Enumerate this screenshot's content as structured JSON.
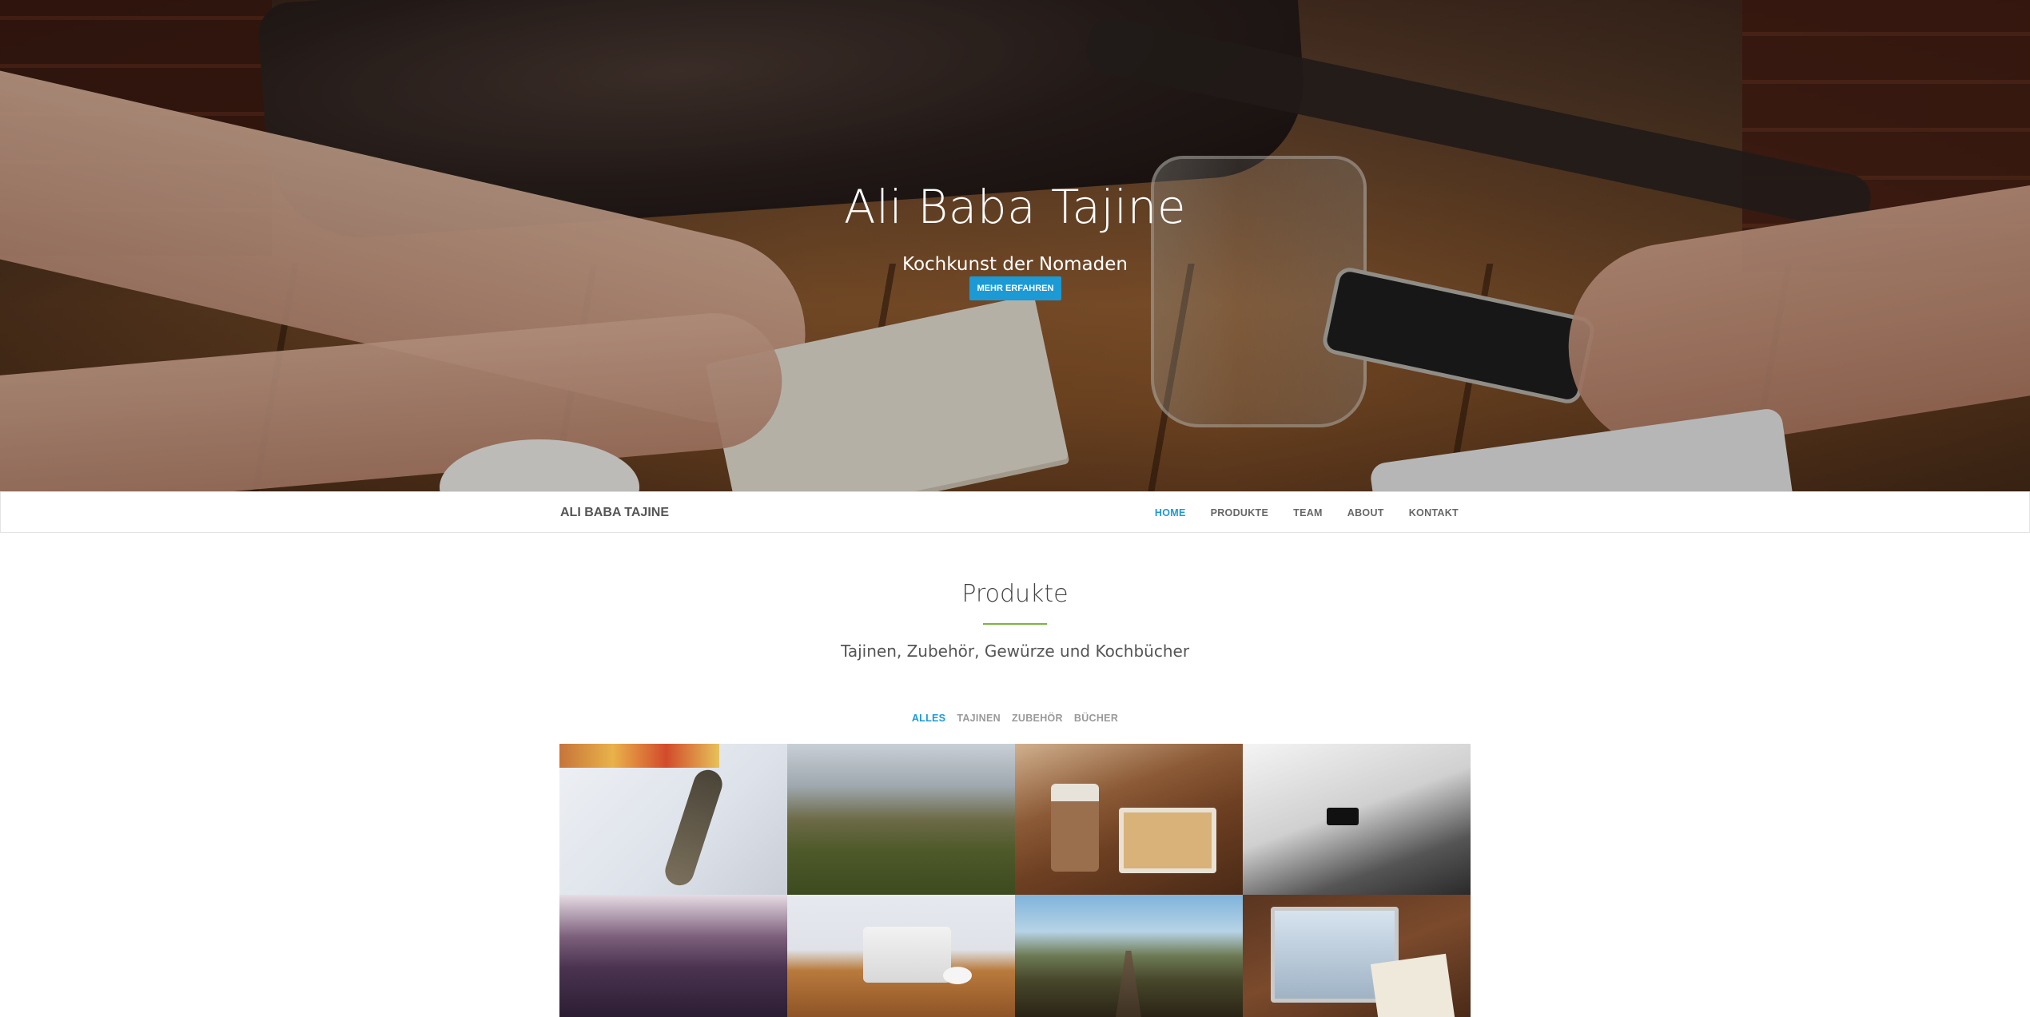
{
  "hero": {
    "title": "Ali Baba Tajine",
    "subtitle": "Kochkunst der Nomaden",
    "button_label": "MEHR ERFAHREN"
  },
  "navbar": {
    "brand": "ALI BABA TAJINE",
    "links": [
      {
        "label": "HOME",
        "active": true
      },
      {
        "label": "PRODUKTE",
        "active": false
      },
      {
        "label": "TEAM",
        "active": false
      },
      {
        "label": "ABOUT",
        "active": false
      },
      {
        "label": "KONTAKT",
        "active": false
      }
    ]
  },
  "products": {
    "title": "Produkte",
    "subtitle": "Tajinen, Zubehör, Gewürze und Kochbücher",
    "filters": [
      {
        "label": "ALLES",
        "active": true
      },
      {
        "label": "TAJINEN",
        "active": false
      },
      {
        "label": "ZUBEHÖR",
        "active": false
      },
      {
        "label": "BÜCHER",
        "active": false
      }
    ]
  },
  "colors": {
    "accent": "#1b9ad6",
    "divider": "#7cb342",
    "nav_text": "#666666",
    "brand_text": "#555555"
  }
}
